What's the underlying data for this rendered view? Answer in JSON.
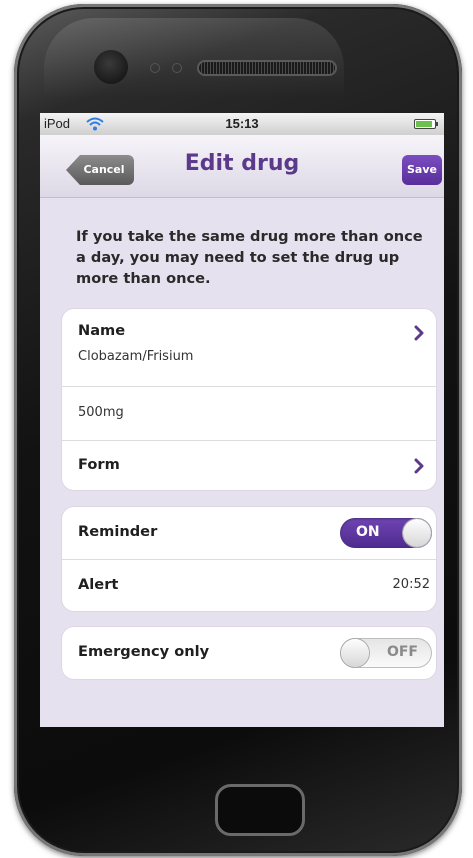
{
  "status_bar": {
    "carrier": "iPod",
    "wifi_icon": "wifi-icon",
    "time": "15:13",
    "battery_icon": "battery-icon"
  },
  "nav": {
    "cancel_label": "Cancel",
    "title": "Edit drug",
    "save_label": "Save"
  },
  "intro_text": "If you take the same drug more than once a day, you may need to set the drug up more than once.",
  "drug_group": {
    "name_label": "Name",
    "name_value": "Clobazam/Frisium",
    "dose_value": "500mg",
    "form_label": "Form",
    "chevron_icon": "chevron-right-icon"
  },
  "reminder_group": {
    "reminder_label": "Reminder",
    "reminder_switch": "ON",
    "alert_label": "Alert",
    "alert_time": "20:52"
  },
  "emergency_group": {
    "emergency_label": "Emergency only",
    "emergency_switch": "OFF"
  },
  "colors": {
    "accent": "#5b3a8c",
    "background": "#e6e1ee"
  }
}
